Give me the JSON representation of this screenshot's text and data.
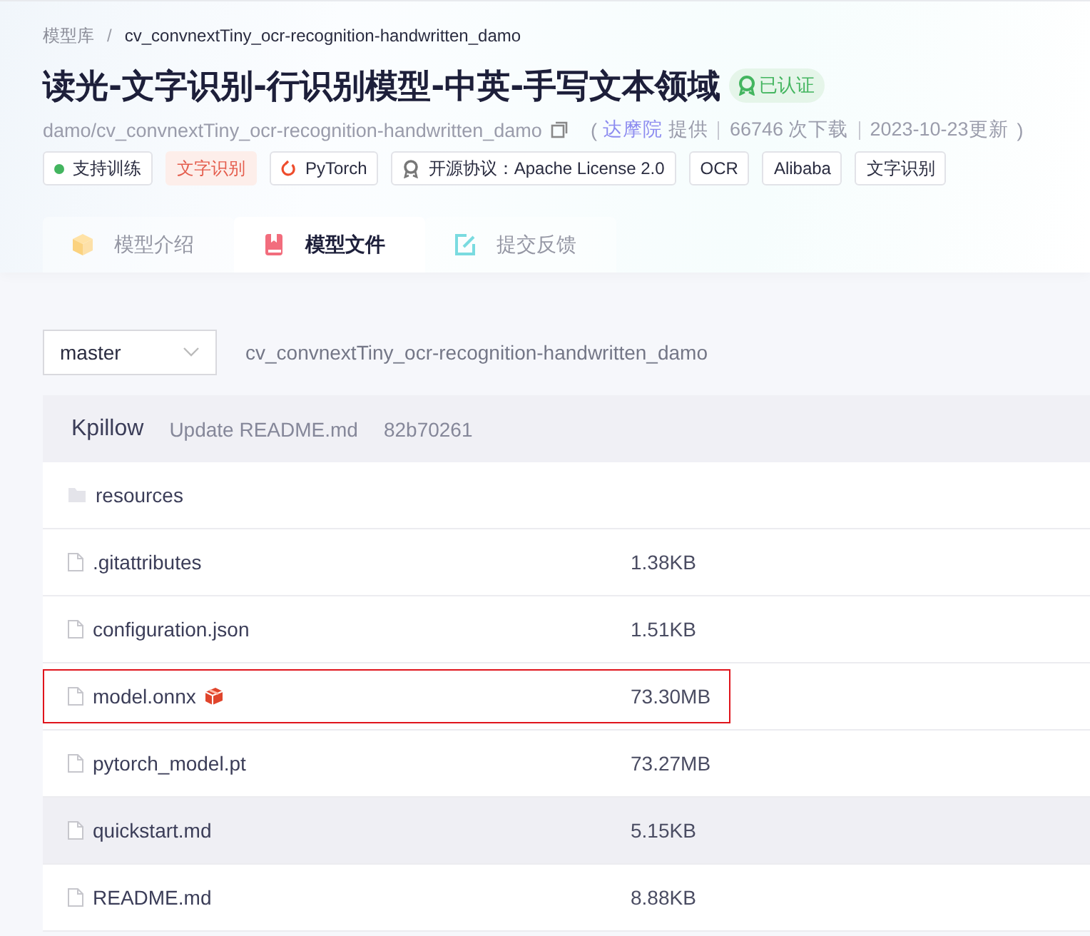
{
  "breadcrumb": [
    {
      "text": "模型库",
      "link": true
    },
    {
      "text": "cv_convnextTiny_ocr-recognition-handwritten_damo",
      "link": false
    }
  ],
  "breadcrumb_separator": "/",
  "title": "读光-文字识别-行识别模型-中英-手写文本领域",
  "verified_badge": "已认证",
  "meta": {
    "model_id": "damo/cv_convnextTiny_ocr-recognition-handwritten_damo",
    "open_paren": "(",
    "provider": "达摩院",
    "provider_suffix": "提供",
    "downloads": "66746 次下载",
    "updated": "2023-10-23更新",
    "close_paren": ")"
  },
  "tags": [
    {
      "kind": "status",
      "text": "支持训练"
    },
    {
      "kind": "task",
      "text": "文字识别"
    },
    {
      "kind": "framework",
      "text": "PyTorch"
    },
    {
      "kind": "license",
      "text": "开源协议：Apache License 2.0"
    },
    {
      "kind": "plain",
      "text": "OCR"
    },
    {
      "kind": "plain",
      "text": "Alibaba"
    },
    {
      "kind": "plain",
      "text": "文字识别"
    }
  ],
  "tabs": [
    {
      "label": "模型介绍",
      "selected": false
    },
    {
      "label": "模型文件",
      "selected": true
    },
    {
      "label": "提交反馈",
      "selected": false
    }
  ],
  "branch_select": {
    "value": "master"
  },
  "repo_name": "cv_convnextTiny_ocr-recognition-handwritten_damo",
  "commit": {
    "author": "Kpillow",
    "message": "Update README.md",
    "hash": "82b70261"
  },
  "files": [
    {
      "kind": "folder",
      "name": "resources",
      "shaded": false,
      "highlighted": false
    },
    {
      "kind": "file",
      "name": ".gitattributes",
      "size": "1.38KB",
      "shaded": false,
      "highlighted": false
    },
    {
      "kind": "file",
      "name": "configuration.json",
      "size": "1.51KB",
      "shaded": false,
      "highlighted": false
    },
    {
      "kind": "model",
      "name": "model.onnx",
      "size": "73.30MB",
      "shaded": false,
      "highlighted": true
    },
    {
      "kind": "file",
      "name": "pytorch_model.pt",
      "size": "73.27MB",
      "shaded": false,
      "highlighted": false
    },
    {
      "kind": "file",
      "name": "quickstart.md",
      "size": "5.15KB",
      "shaded": true,
      "highlighted": false
    },
    {
      "kind": "file",
      "name": "README.md",
      "size": "8.88KB",
      "shaded": false,
      "highlighted": false
    }
  ]
}
